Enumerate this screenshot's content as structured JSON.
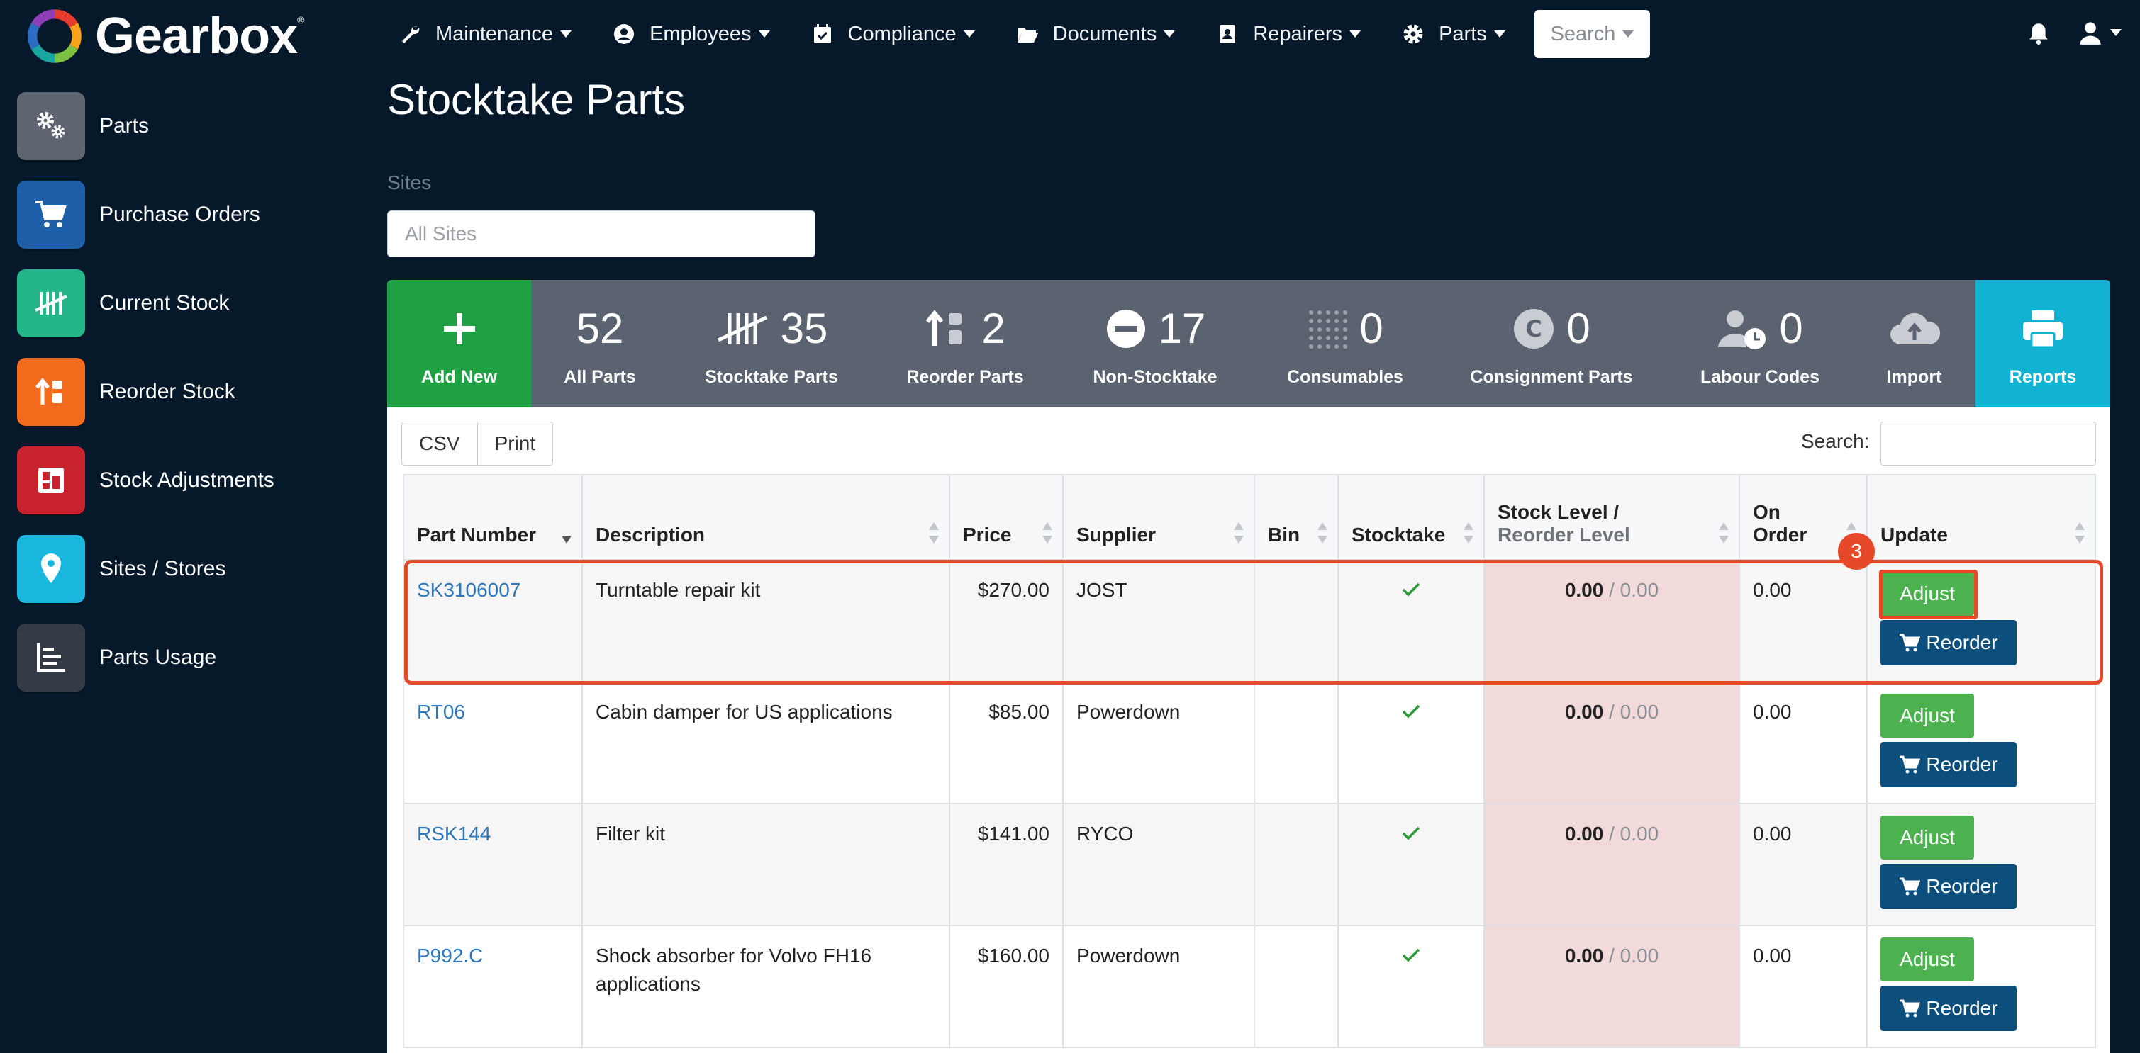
{
  "brand": {
    "name": "Gearbox",
    "tm": "®"
  },
  "nav": {
    "items": [
      {
        "label": "Maintenance"
      },
      {
        "label": "Employees"
      },
      {
        "label": "Compliance"
      },
      {
        "label": "Documents"
      },
      {
        "label": "Repairers"
      },
      {
        "label": "Parts"
      }
    ],
    "search_label": "Search"
  },
  "sidebar": {
    "items": [
      {
        "label": "Parts",
        "color": "#5e6570",
        "icon": "gears-icon"
      },
      {
        "label": "Purchase Orders",
        "color": "#1d5fa8",
        "icon": "cart-icon"
      },
      {
        "label": "Current Stock",
        "color": "#25b58a",
        "icon": "tally-icon"
      },
      {
        "label": "Reorder Stock",
        "color": "#f26a1b",
        "icon": "reorder-icon"
      },
      {
        "label": "Stock Adjustments",
        "color": "#c8232c",
        "icon": "adjust-icon"
      },
      {
        "label": "Sites / Stores",
        "color": "#19b6dd",
        "icon": "map-pin-icon"
      },
      {
        "label": "Parts Usage",
        "color": "#343a46",
        "icon": "bar-chart-icon"
      }
    ]
  },
  "page": {
    "title": "Stocktake Parts",
    "sites_label": "Sites",
    "sites_placeholder": "All Sites"
  },
  "stats": {
    "add_new": "Add New",
    "tiles": [
      {
        "num": "52",
        "label": "All Parts"
      },
      {
        "num": "35",
        "label": "Stocktake Parts"
      },
      {
        "num": "2",
        "label": "Reorder Parts"
      },
      {
        "num": "17",
        "label": "Non-Stocktake"
      },
      {
        "num": "0",
        "label": "Consumables"
      },
      {
        "num": "0",
        "label": "Consignment Parts"
      },
      {
        "num": "0",
        "label": "Labour Codes"
      }
    ],
    "import": "Import",
    "reports": "Reports"
  },
  "toolbar": {
    "csv": "CSV",
    "print": "Print",
    "search_label": "Search:"
  },
  "table": {
    "columns": {
      "part_number": "Part Number",
      "description": "Description",
      "price": "Price",
      "supplier": "Supplier",
      "bin": "Bin",
      "stocktake": "Stocktake",
      "stock_level": "Stock Level /",
      "reorder_level": "Reorder Level",
      "on_order_1": "On",
      "on_order_2": "Order",
      "update": "Update"
    },
    "rows": [
      {
        "part": "SK3106007",
        "desc": "Turntable repair kit",
        "price": "$270.00",
        "supplier": "JOST",
        "bin": "",
        "stock": "0.00",
        "reorder": " / 0.00",
        "on_order": "0.00"
      },
      {
        "part": "RT06",
        "desc": "Cabin damper for US applications",
        "price": "$85.00",
        "supplier": "Powerdown",
        "bin": "",
        "stock": "0.00",
        "reorder": " / 0.00",
        "on_order": "0.00"
      },
      {
        "part": "RSK144",
        "desc": "Filter kit",
        "price": "$141.00",
        "supplier": "RYCO",
        "bin": "",
        "stock": "0.00",
        "reorder": " / 0.00",
        "on_order": "0.00"
      },
      {
        "part": "P992.C",
        "desc": "Shock absorber for Volvo FH16 applications",
        "price": "$160.00",
        "supplier": "Powerdown",
        "bin": "",
        "stock": "0.00",
        "reorder": " / 0.00",
        "on_order": "0.00"
      }
    ],
    "adjust_label": "Adjust",
    "reorder_label": "Reorder"
  },
  "annotation": {
    "badge": "3"
  }
}
